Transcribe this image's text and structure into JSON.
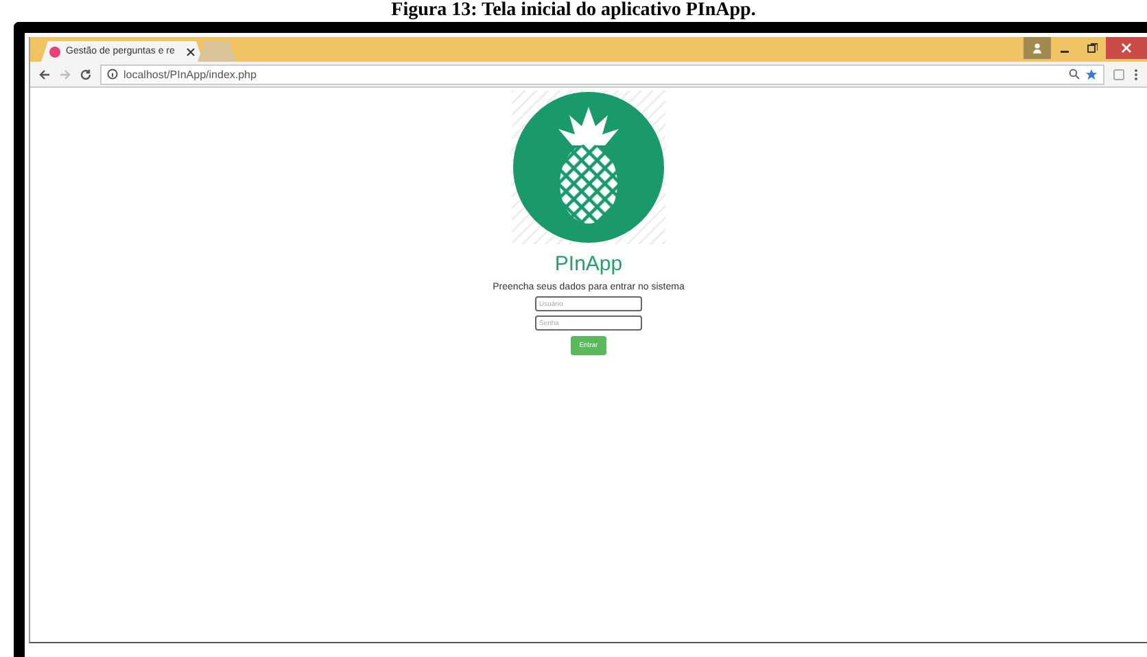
{
  "caption": "Figura 13: Tela inicial do aplicativo PInApp.",
  "browser": {
    "tabs": [
      {
        "title": "Gestão de perguntas e re",
        "selected": true
      },
      {
        "selected": false
      }
    ],
    "address": "localhost/PInApp/index.php",
    "bookmarked": true
  },
  "page": {
    "app_name": "PInApp",
    "prompt": "Preencha seus dados para entrar no sistema",
    "fields": [
      {
        "placeholder": "Usuário"
      },
      {
        "placeholder": "Senha"
      }
    ],
    "submit": "Entrar"
  }
}
